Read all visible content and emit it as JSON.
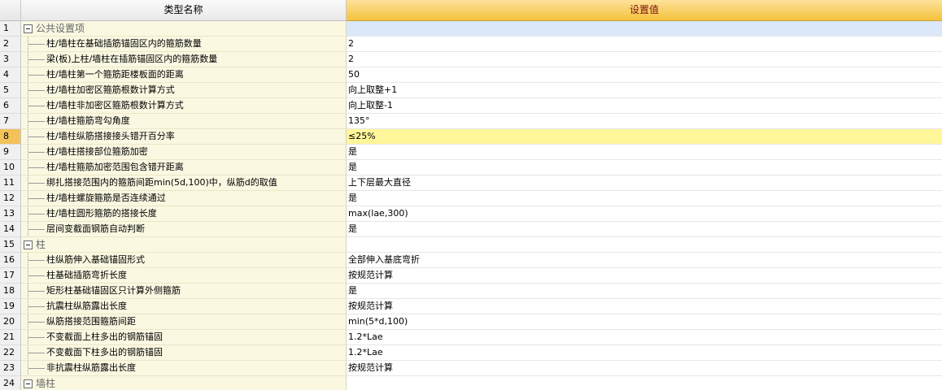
{
  "header": {
    "name_col": "类型名称",
    "value_col": "设置值"
  },
  "rows": [
    {
      "num": "1",
      "type": "group",
      "label": "公共设置项",
      "value": ""
    },
    {
      "num": "2",
      "type": "item",
      "label": "柱/墙柱在基础插筋锚固区内的箍筋数量",
      "value": "2"
    },
    {
      "num": "3",
      "type": "item",
      "label": "梁(板)上柱/墙柱在插筋锚固区内的箍筋数量",
      "value": "2"
    },
    {
      "num": "4",
      "type": "item",
      "label": "柱/墙柱第一个箍筋距楼板面的距离",
      "value": "50"
    },
    {
      "num": "5",
      "type": "item",
      "label": "柱/墙柱加密区箍筋根数计算方式",
      "value": "向上取整+1"
    },
    {
      "num": "6",
      "type": "item",
      "label": "柱/墙柱非加密区箍筋根数计算方式",
      "value": "向上取整-1"
    },
    {
      "num": "7",
      "type": "item",
      "label": "柱/墙柱箍筋弯勾角度",
      "value": "135°"
    },
    {
      "num": "8",
      "type": "item",
      "label": "柱/墙柱纵筋搭接接头错开百分率",
      "value": "≤25%",
      "selected": true
    },
    {
      "num": "9",
      "type": "item",
      "label": "柱/墙柱搭接部位箍筋加密",
      "value": "是"
    },
    {
      "num": "10",
      "type": "item",
      "label": "柱/墙柱箍筋加密范围包含错开距离",
      "value": "是"
    },
    {
      "num": "11",
      "type": "item",
      "label": "绑扎搭接范围内的箍筋间距min(5d,100)中，纵筋d的取值",
      "value": "上下层最大直径"
    },
    {
      "num": "12",
      "type": "item",
      "label": "柱/墙柱螺旋箍筋是否连续通过",
      "value": "是"
    },
    {
      "num": "13",
      "type": "item",
      "label": "柱/墙柱圆形箍筋的搭接长度",
      "value": "max(lae,300)"
    },
    {
      "num": "14",
      "type": "item",
      "label": "层间变截面钢筋自动判断",
      "value": "是"
    },
    {
      "num": "15",
      "type": "group",
      "label": "柱",
      "value": ""
    },
    {
      "num": "16",
      "type": "item",
      "label": "柱纵筋伸入基础锚固形式",
      "value": "全部伸入基底弯折"
    },
    {
      "num": "17",
      "type": "item",
      "label": "柱基础插筋弯折长度",
      "value": "按规范计算"
    },
    {
      "num": "18",
      "type": "item",
      "label": "矩形柱基础锚固区只计算外侧箍筋",
      "value": "是"
    },
    {
      "num": "19",
      "type": "item",
      "label": "抗震柱纵筋露出长度",
      "value": "按规范计算"
    },
    {
      "num": "20",
      "type": "item",
      "label": "纵筋搭接范围箍筋间距",
      "value": "min(5*d,100)"
    },
    {
      "num": "21",
      "type": "item",
      "label": "不变截面上柱多出的钢筋锚固",
      "value": "1.2*Lae"
    },
    {
      "num": "22",
      "type": "item",
      "label": "不变截面下柱多出的钢筋锚固",
      "value": "1.2*Lae"
    },
    {
      "num": "23",
      "type": "item",
      "label": "非抗震柱纵筋露出长度",
      "value": "按规范计算"
    },
    {
      "num": "24",
      "type": "group",
      "label": "墙柱",
      "value": ""
    }
  ]
}
